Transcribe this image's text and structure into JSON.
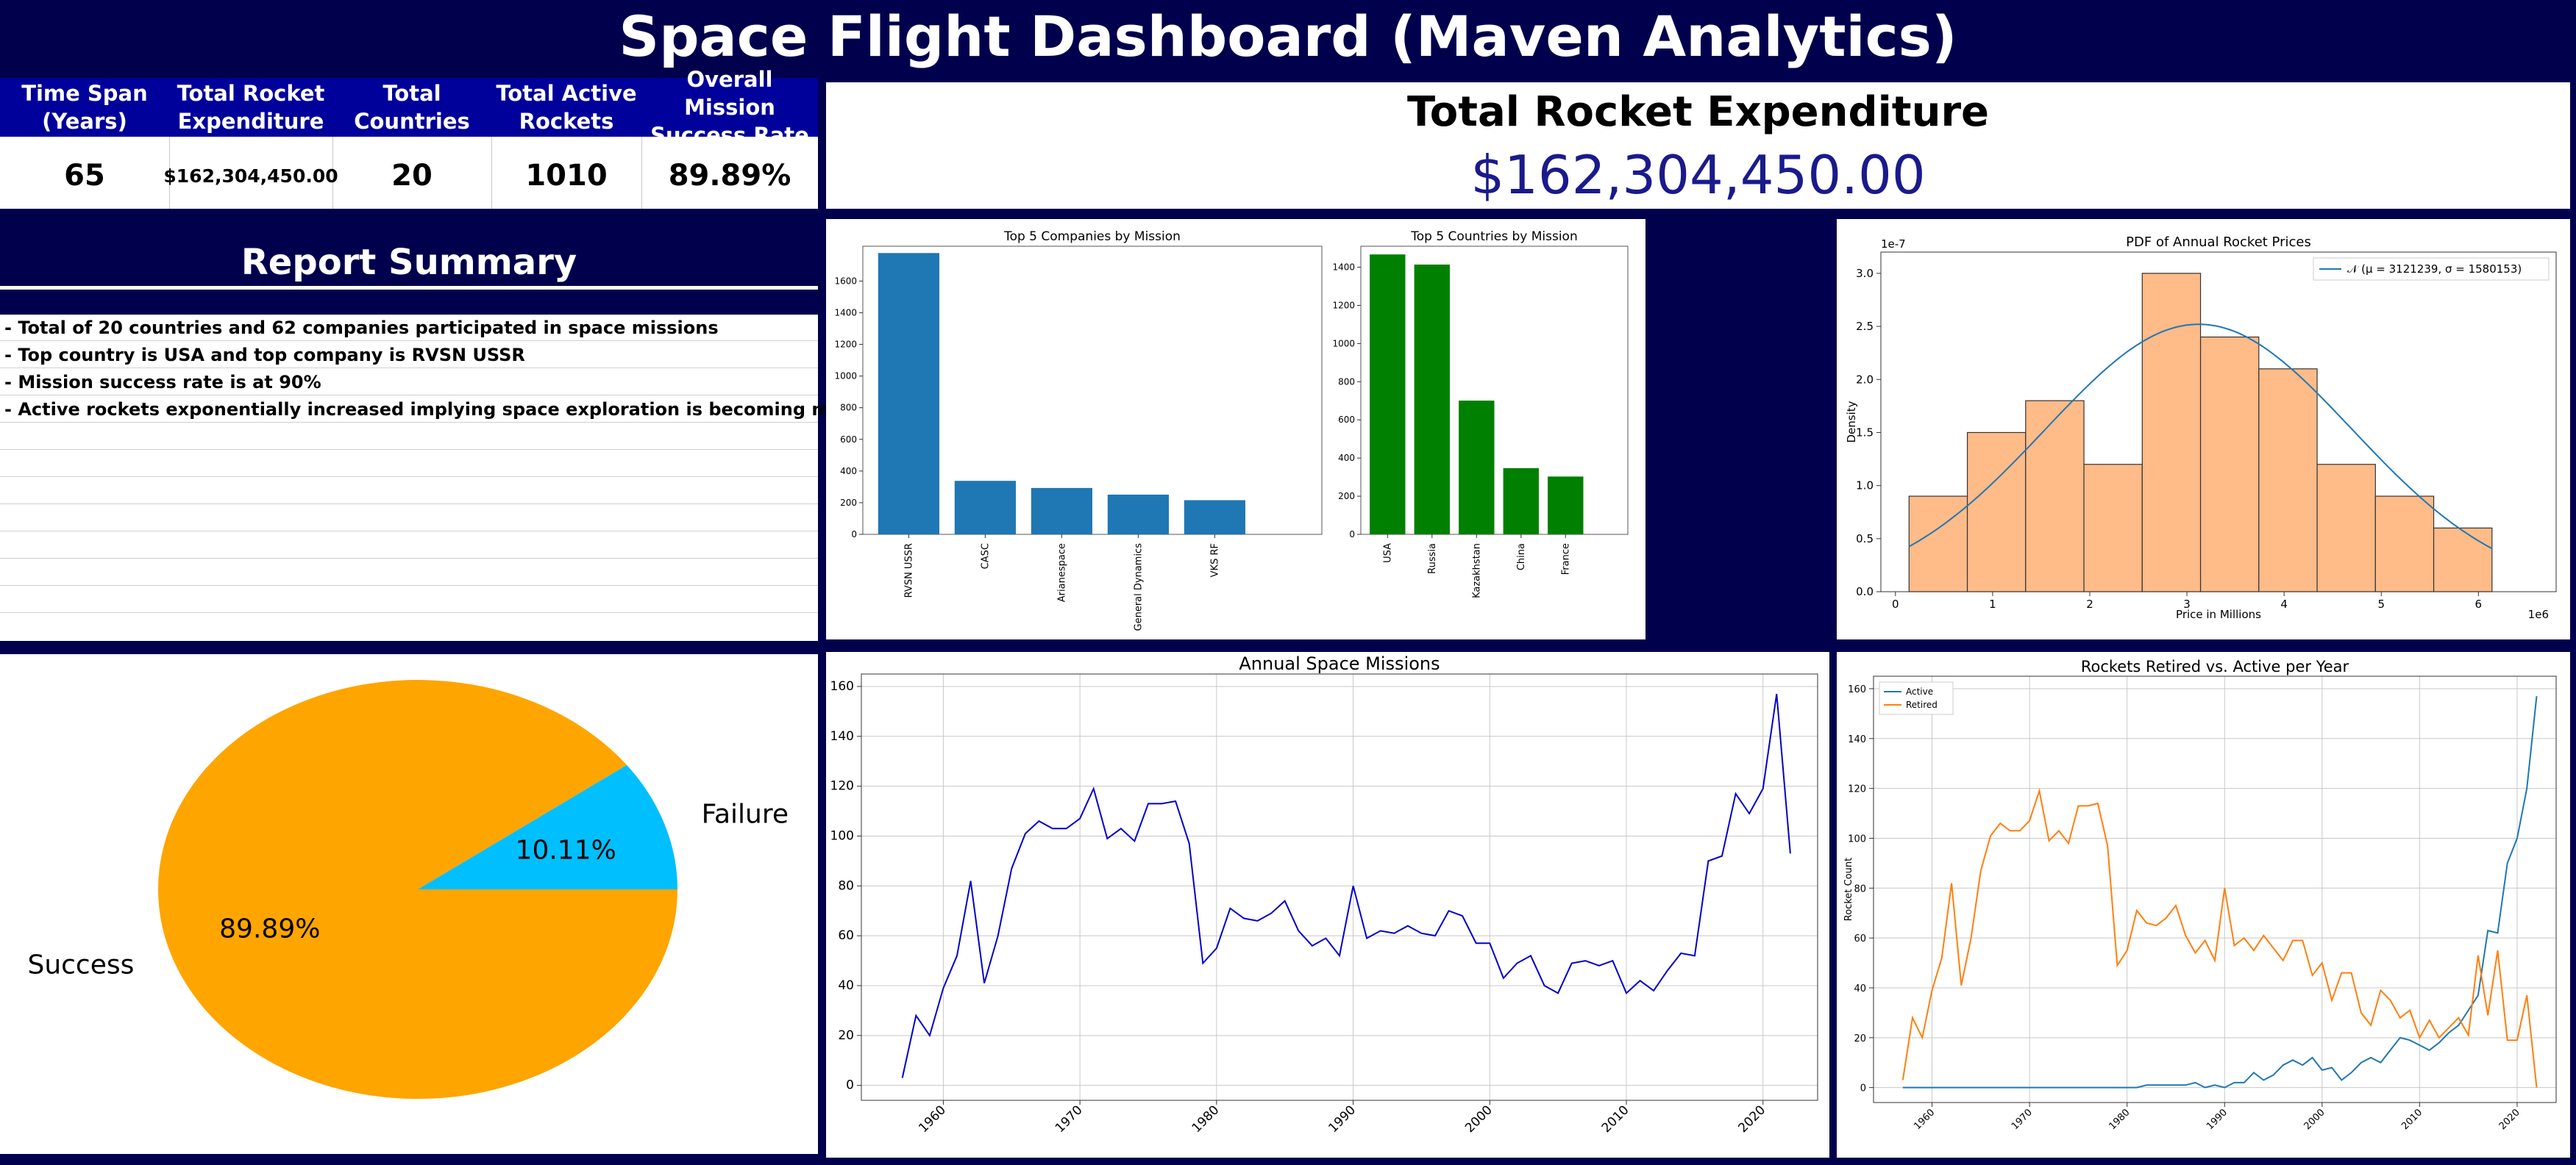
{
  "title": "Space Flight Dashboard (Maven Analytics)",
  "kpis": [
    {
      "label": "Time Span (Years)",
      "value": "65"
    },
    {
      "label": "Total Rocket Expenditure",
      "value": "$162,304,450.00"
    },
    {
      "label": "Total Countries",
      "value": "20"
    },
    {
      "label": "Total Active Rockets",
      "value": "1010"
    },
    {
      "label": "Overall Mission Success Rate",
      "value": "89.89%"
    }
  ],
  "total_panel": {
    "title": "Total Rocket Expenditure",
    "value": "$162,304,450.00"
  },
  "summary": {
    "title": "Report Summary",
    "lines": [
      "- Total of 20 countries and 62 companies participated in space missions",
      "- Top country is USA and top company is RVSN USSR",
      "- Mission success rate is at 90%",
      "- Active rockets exponentially increased implying space exploration is becoming more popular",
      "",
      "",
      "",
      "",
      "",
      "",
      ""
    ]
  },
  "colors": {
    "background": "#00004d",
    "header_fill": "#00009a",
    "company_bar": "#1f77b4",
    "country_bar": "#008000",
    "hist_fill": "#ffbb88",
    "pdf_line": "#1f77b4",
    "success": "#ffa500",
    "failure": "#00bfff",
    "missions_line": "#0000cc",
    "active_line": "#1f77b4",
    "retired_line": "#ff7f0e"
  },
  "chart_data": [
    {
      "id": "companies",
      "type": "bar",
      "title": "Top 5 Companies by Mission",
      "categories": [
        "RVSN USSR",
        "CASC",
        "Arianespace",
        "General Dynamics",
        "VKS RF"
      ],
      "values": [
        1777,
        338,
        293,
        251,
        216
      ],
      "ylim": [
        0,
        1820
      ],
      "yticks": [
        0,
        200,
        400,
        600,
        800,
        1000,
        1200,
        1400,
        1600
      ]
    },
    {
      "id": "countries",
      "type": "bar",
      "title": "Top 5 Countries by Mission",
      "categories": [
        "USA",
        "Russia",
        "Kazakhstan",
        "China",
        "France"
      ],
      "values": [
        1467,
        1414,
        701,
        347,
        303
      ],
      "ylim": [
        0,
        1510
      ],
      "yticks": [
        0,
        200,
        400,
        600,
        800,
        1000,
        1200,
        1400
      ]
    },
    {
      "id": "pdf",
      "type": "bar",
      "title": "PDF of Annual Rocket Prices",
      "xlabel": "Price in Millions",
      "ylabel": "Density",
      "x_multiplier": "1e6",
      "y_multiplier": "1e-7",
      "legend": "𝒩 (μ = 3121239, σ = 1580153)",
      "legend_position": "top-right",
      "bin_edges": [
        0.14,
        0.74,
        1.34,
        1.94,
        2.54,
        3.14,
        3.74,
        4.34,
        4.94,
        5.54,
        6.14
      ],
      "densities": [
        0.9,
        1.5,
        1.8,
        1.2,
        3.0,
        2.4,
        2.1,
        1.2,
        0.9,
        0.6
      ],
      "pdf_curve": {
        "mu": 3121239,
        "sigma": 1580153,
        "peak": 2.52
      },
      "xlim": [
        -0.15,
        6.8
      ],
      "ylim": [
        0,
        3.2
      ],
      "xticks": [
        0,
        1,
        2,
        3,
        4,
        5,
        6
      ],
      "yticks": [
        0.0,
        0.5,
        1.0,
        1.5,
        2.0,
        2.5,
        3.0
      ]
    },
    {
      "id": "success",
      "type": "pie",
      "labels": [
        "Success",
        "Failure"
      ],
      "values": [
        89.89,
        10.11
      ],
      "value_labels": [
        "89.89%",
        "10.11%"
      ]
    },
    {
      "id": "missions",
      "type": "line",
      "title": "Annual Space Missions",
      "x": [
        1957,
        1958,
        1959,
        1960,
        1961,
        1962,
        1963,
        1964,
        1965,
        1966,
        1967,
        1968,
        1969,
        1970,
        1971,
        1972,
        1973,
        1974,
        1975,
        1976,
        1977,
        1978,
        1979,
        1980,
        1981,
        1982,
        1983,
        1984,
        1985,
        1986,
        1987,
        1988,
        1989,
        1990,
        1991,
        1992,
        1993,
        1994,
        1995,
        1996,
        1997,
        1998,
        1999,
        2000,
        2001,
        2002,
        2003,
        2004,
        2005,
        2006,
        2007,
        2008,
        2009,
        2010,
        2011,
        2012,
        2013,
        2014,
        2015,
        2016,
        2017,
        2018,
        2019,
        2020,
        2021,
        2022
      ],
      "y": [
        3,
        28,
        20,
        39,
        52,
        82,
        41,
        60,
        87,
        101,
        106,
        103,
        103,
        107,
        119,
        99,
        103,
        98,
        113,
        113,
        114,
        97,
        49,
        55,
        71,
        67,
        66,
        69,
        74,
        62,
        56,
        59,
        52,
        80,
        59,
        62,
        61,
        64,
        61,
        60,
        70,
        68,
        57,
        57,
        43,
        49,
        52,
        40,
        37,
        49,
        50,
        48,
        50,
        37,
        42,
        38,
        46,
        53,
        52,
        90,
        92,
        117,
        109,
        119,
        157,
        93
      ],
      "xlim": [
        1954,
        2024
      ],
      "ylim": [
        -6,
        165
      ],
      "xticks": [
        1960,
        1970,
        1980,
        1990,
        2000,
        2010,
        2020
      ],
      "yticks": [
        0,
        20,
        40,
        60,
        80,
        100,
        120,
        140,
        160
      ]
    },
    {
      "id": "rockets",
      "type": "line",
      "title": "Rockets Retired vs. Active per Year",
      "ylabel": "Rocket Count",
      "legend_position": "top-left",
      "x": [
        1957,
        1958,
        1959,
        1960,
        1961,
        1962,
        1963,
        1964,
        1965,
        1966,
        1967,
        1968,
        1969,
        1970,
        1971,
        1972,
        1973,
        1974,
        1975,
        1976,
        1977,
        1978,
        1979,
        1980,
        1981,
        1982,
        1983,
        1984,
        1985,
        1986,
        1987,
        1988,
        1989,
        1990,
        1991,
        1992,
        1993,
        1994,
        1995,
        1996,
        1997,
        1998,
        1999,
        2000,
        2001,
        2002,
        2003,
        2004,
        2005,
        2006,
        2007,
        2008,
        2009,
        2010,
        2011,
        2012,
        2013,
        2014,
        2015,
        2016,
        2017,
        2018,
        2019,
        2020,
        2021,
        2022
      ],
      "series": [
        {
          "name": "Active",
          "values": [
            0,
            0,
            0,
            0,
            0,
            0,
            0,
            0,
            0,
            0,
            0,
            0,
            0,
            0,
            0,
            0,
            0,
            0,
            0,
            0,
            0,
            0,
            0,
            0,
            0,
            1,
            1,
            1,
            1,
            1,
            2,
            0,
            1,
            0,
            2,
            2,
            6,
            3,
            5,
            9,
            11,
            9,
            12,
            7,
            8,
            3,
            6,
            10,
            12,
            10,
            15,
            20,
            19,
            17,
            15,
            18,
            22,
            25,
            31,
            37,
            63,
            62,
            90,
            100,
            120,
            157
          ]
        },
        {
          "name": "Retired",
          "values": [
            3,
            28,
            20,
            39,
            52,
            82,
            41,
            60,
            87,
            101,
            106,
            103,
            103,
            107,
            119,
            99,
            103,
            98,
            113,
            113,
            114,
            97,
            49,
            55,
            71,
            66,
            65,
            68,
            73,
            61,
            54,
            59,
            51,
            80,
            57,
            60,
            55,
            61,
            56,
            51,
            59,
            59,
            45,
            50,
            35,
            46,
            46,
            30,
            25,
            39,
            35,
            28,
            31,
            20,
            27,
            20,
            24,
            28,
            21,
            53,
            29,
            55,
            19,
            19,
            37,
            0
          ]
        }
      ],
      "xlim": [
        1954,
        2024
      ],
      "ylim": [
        -6,
        165
      ],
      "xticks": [
        1960,
        1970,
        1980,
        1990,
        2000,
        2010,
        2020
      ],
      "yticks": [
        0,
        20,
        40,
        60,
        80,
        100,
        120,
        140,
        160
      ]
    }
  ]
}
